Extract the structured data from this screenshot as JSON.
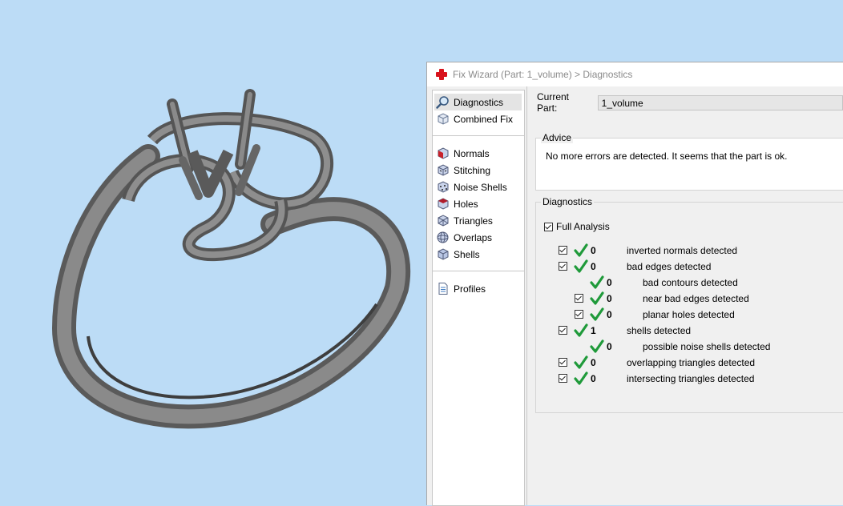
{
  "window": {
    "title": "Fix Wizard (Part: 1_volume) > Diagnostics"
  },
  "sidebar": {
    "group1": [
      {
        "label": "Diagnostics",
        "icon": "magnifier-icon",
        "selected": true
      },
      {
        "label": "Combined Fix",
        "icon": "cube-icon"
      }
    ],
    "group2": [
      {
        "label": "Normals",
        "icon": "normals-cube-icon"
      },
      {
        "label": "Stitching",
        "icon": "stitching-cube-icon"
      },
      {
        "label": "Noise Shells",
        "icon": "noise-shells-cube-icon"
      },
      {
        "label": "Holes",
        "icon": "holes-cube-icon"
      },
      {
        "label": "Triangles",
        "icon": "triangles-cube-icon"
      },
      {
        "label": "Overlaps",
        "icon": "overlaps-sphere-icon"
      },
      {
        "label": "Shells",
        "icon": "shells-cube-icon"
      }
    ],
    "group3": [
      {
        "label": "Profiles",
        "icon": "document-icon"
      }
    ]
  },
  "main": {
    "current_part_label": "Current Part:",
    "current_part_value": "1_volume",
    "advice": {
      "title": "Advice",
      "text": "No more errors are detected. It seems that the part is ok."
    },
    "diagnostics": {
      "title": "Diagnostics",
      "full_analysis_label": "Full Analysis",
      "full_analysis_checked": true,
      "rows": [
        {
          "count": "0",
          "text": "inverted normals detected",
          "indent": 0,
          "checkbox": true
        },
        {
          "count": "0",
          "text": "bad edges detected",
          "indent": 0,
          "checkbox": true
        },
        {
          "count": "0",
          "text": "bad contours detected",
          "indent": 1,
          "checkbox": false
        },
        {
          "count": "0",
          "text": "near bad edges detected",
          "indent": 1,
          "checkbox": true
        },
        {
          "count": "0",
          "text": "planar holes detected",
          "indent": 1,
          "checkbox": true
        },
        {
          "count": "1",
          "text": "shells detected",
          "indent": 0,
          "checkbox": true
        },
        {
          "count": "0",
          "text": "possible noise shells detected",
          "indent": 1,
          "checkbox": false
        },
        {
          "count": "0",
          "text": "overlapping triangles detected",
          "indent": 0,
          "checkbox": true
        },
        {
          "count": "0",
          "text": "intersecting triangles detected",
          "indent": 0,
          "checkbox": true
        }
      ]
    }
  },
  "colors": {
    "viewport_bg": "#bcdcf6",
    "model": "#6b6b6b",
    "check_green": "#1f9a3a",
    "title_icon_red": "#d8121c"
  }
}
